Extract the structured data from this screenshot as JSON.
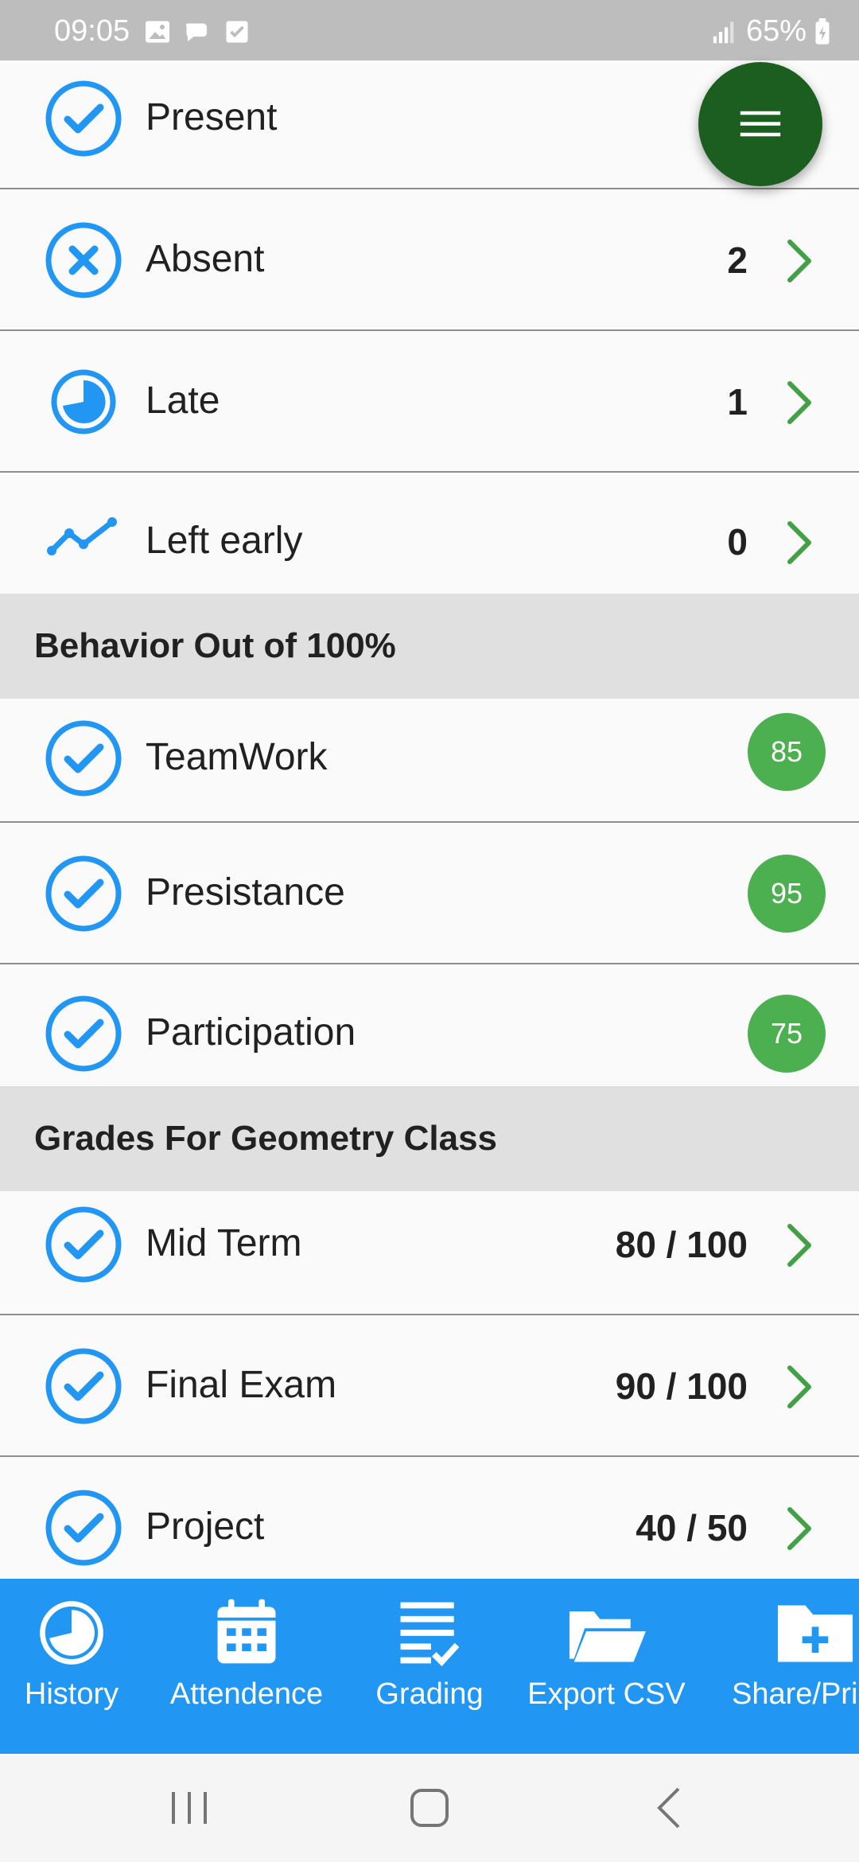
{
  "status_bar": {
    "time": "09:05",
    "battery": "65%"
  },
  "attendance": [
    {
      "label": "Present",
      "value": "",
      "icon": "check-circle-icon"
    },
    {
      "label": "Absent",
      "value": "2",
      "icon": "x-circle-icon"
    },
    {
      "label": "Late",
      "value": "1",
      "icon": "clock-pie-icon"
    },
    {
      "label": "Left early",
      "value": "0",
      "icon": "trend-line-icon"
    }
  ],
  "behavior": {
    "header": "Behavior Out of 100%",
    "items": [
      {
        "label": "TeamWork",
        "score": "85"
      },
      {
        "label": "Presistance",
        "score": "95"
      },
      {
        "label": "Participation",
        "score": "75"
      }
    ]
  },
  "grades": {
    "header": "Grades For Geometry Class",
    "items": [
      {
        "label": "Mid Term",
        "value": "80 / 100"
      },
      {
        "label": "Final Exam",
        "value": "90 / 100"
      },
      {
        "label": "Project",
        "value": "40 / 50"
      }
    ]
  },
  "bottom_nav": [
    {
      "label": "History",
      "icon": "history-icon"
    },
    {
      "label": "Attendence",
      "icon": "calendar-icon"
    },
    {
      "label": "Grading",
      "icon": "checklist-icon"
    },
    {
      "label": "Export CSV",
      "icon": "folder-open-icon"
    },
    {
      "label": "Share/Pri",
      "icon": "folder-plus-icon"
    }
  ],
  "colors": {
    "primary": "#2196f3",
    "accent_green": "#4caf50",
    "fab": "#1b5e20",
    "chevron": "#43a047",
    "section_bg": "#e0e0e0"
  }
}
